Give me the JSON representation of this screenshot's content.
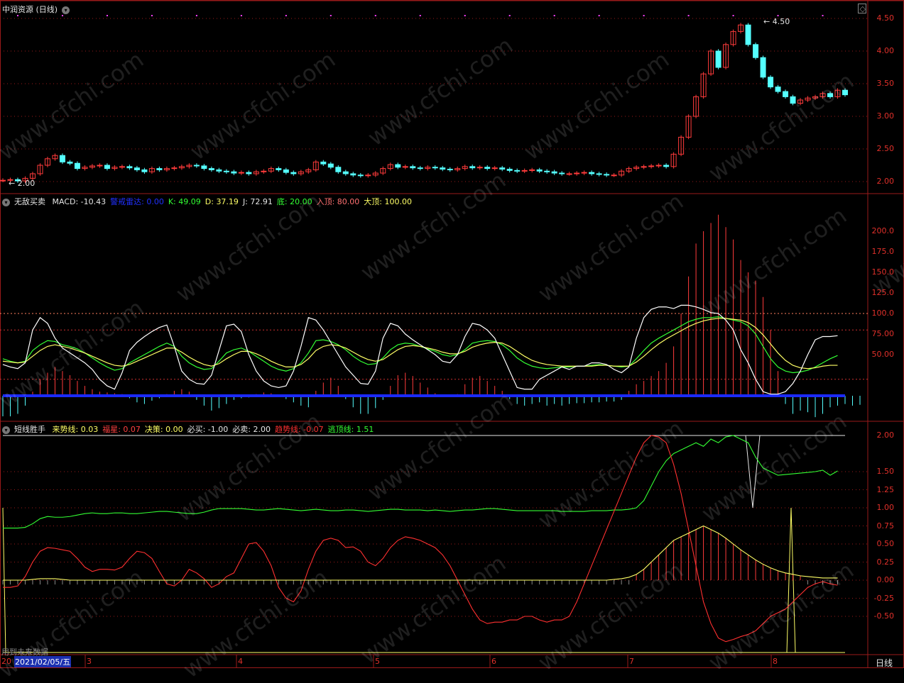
{
  "panel1": {
    "title": "中润资源 (日线)",
    "hi_label": "4.50",
    "lo_label": "2.00",
    "yticks": [
      "4.50",
      "4.00",
      "3.50",
      "3.00",
      "2.50",
      "2.00"
    ]
  },
  "panel2": {
    "name": "无敌买卖",
    "items": [
      {
        "label": "MACD: -10.43",
        "color": "#e6e6e6"
      },
      {
        "label": "警戒雷达: 0.00",
        "color": "#2030ff"
      },
      {
        "label": "K: 49.09",
        "color": "#33ff33"
      },
      {
        "label": "D: 37.19",
        "color": "#ffff66"
      },
      {
        "label": "J: 72.91",
        "color": "#e6e6e6"
      },
      {
        "label": "底: 20.00",
        "color": "#33ff33"
      },
      {
        "label": "入顶: 80.00",
        "color": "#ff7070"
      },
      {
        "label": "大顶: 100.00",
        "color": "#ffff66"
      }
    ],
    "yticks": [
      "200.0",
      "175.0",
      "150.0",
      "125.0",
      "100.0",
      "75.00",
      "50.00"
    ]
  },
  "panel3": {
    "name": "短线胜手",
    "items": [
      {
        "label": "来势线: 0.03",
        "color": "#ffff66"
      },
      {
        "label": "福星: 0.07",
        "color": "#ff4040"
      },
      {
        "label": "决策: 0.00",
        "color": "#ffff66"
      },
      {
        "label": "必买: -1.00",
        "color": "#e6e6e6"
      },
      {
        "label": "必卖: 2.00",
        "color": "#e6e6e6"
      },
      {
        "label": "趋势线: -0.07",
        "color": "#ff3030"
      },
      {
        "label": "逃顶线: 1.51",
        "color": "#33ff33"
      }
    ],
    "yticks": [
      "2.00",
      "1.50",
      "1.25",
      "1.00",
      "0.75",
      "0.50",
      "0.25",
      "0.00",
      "-0.25",
      "-0.50"
    ],
    "footnote": "用到未来数据"
  },
  "dateaxis": {
    "cursor": "2021/02/05/五",
    "months": [
      "3",
      "4",
      "5",
      "6",
      "7",
      "8"
    ],
    "period": "日线"
  },
  "watermark": "www.cfchi.com",
  "colors": {
    "up": "#ff3b3b",
    "down": "#54ffff",
    "grid": "#9a1a1a",
    "axis": "#e0302a"
  },
  "chart_data": {
    "type": "line",
    "title": "中润资源 (日线)",
    "candles_close": [
      2.02,
      2.03,
      2.01,
      2.05,
      2.12,
      2.25,
      2.35,
      2.4,
      2.3,
      2.28,
      2.2,
      2.22,
      2.24,
      2.25,
      2.2,
      2.22,
      2.23,
      2.21,
      2.18,
      2.15,
      2.2,
      2.18,
      2.2,
      2.21,
      2.23,
      2.25,
      2.24,
      2.2,
      2.18,
      2.16,
      2.15,
      2.13,
      2.14,
      2.12,
      2.15,
      2.16,
      2.2,
      2.18,
      2.14,
      2.12,
      2.15,
      2.18,
      2.3,
      2.27,
      2.22,
      2.15,
      2.12,
      2.1,
      2.09,
      2.1,
      2.13,
      2.2,
      2.26,
      2.22,
      2.23,
      2.21,
      2.2,
      2.22,
      2.21,
      2.19,
      2.18,
      2.2,
      2.23,
      2.21,
      2.22,
      2.2,
      2.21,
      2.19,
      2.17,
      2.16,
      2.17,
      2.18,
      2.16,
      2.15,
      2.13,
      2.12,
      2.12,
      2.13,
      2.14,
      2.12,
      2.11,
      2.1,
      2.1,
      2.16,
      2.2,
      2.22,
      2.23,
      2.24,
      2.25,
      2.23,
      2.42,
      2.68,
      3.0,
      3.3,
      3.65,
      4.0,
      3.75,
      4.1,
      4.3,
      4.4,
      4.1,
      3.9,
      3.6,
      3.45,
      3.38,
      3.3,
      3.2,
      3.25,
      3.28,
      3.3,
      3.35,
      3.3,
      3.4,
      3.33
    ],
    "macd_bars": [
      -25,
      -25,
      -22,
      -12,
      5,
      20,
      28,
      35,
      30,
      25,
      18,
      12,
      8,
      5,
      4,
      3,
      2,
      -3,
      -8,
      -10,
      -6,
      -3,
      2,
      6,
      8,
      5,
      -5,
      -12,
      -18,
      -15,
      -10,
      -5,
      -3,
      -2,
      2,
      4,
      3,
      1,
      -4,
      -8,
      -12,
      -14,
      6,
      16,
      22,
      12,
      -4,
      -14,
      -22,
      -22,
      -15,
      -5,
      12,
      25,
      28,
      24,
      16,
      10,
      3,
      -1,
      0,
      2,
      14,
      22,
      24,
      18,
      12,
      6,
      -4,
      -10,
      -12,
      -10,
      -8,
      -12,
      -10,
      -12,
      -10,
      -9,
      -9,
      -8,
      -8,
      -7,
      -7,
      -5,
      6,
      14,
      18,
      24,
      30,
      40,
      60,
      100,
      145,
      185,
      200,
      210,
      220,
      205,
      190,
      165,
      150,
      140,
      120,
      80,
      30,
      -10,
      -22,
      -18,
      -20,
      -26,
      -22,
      -14,
      -12,
      -10,
      -12,
      -11
    ],
    "series_kdj": [
      {
        "name": "K",
        "values": [
          45,
          42,
          40,
          42,
          55,
          62,
          67,
          66,
          62,
          60,
          57,
          52,
          46,
          40,
          35,
          31,
          33,
          40,
          45,
          50,
          55,
          60,
          64,
          60,
          48,
          40,
          35,
          32,
          33,
          42,
          52,
          56,
          58,
          54,
          48,
          42,
          36,
          32,
          30,
          33,
          40,
          52,
          67,
          68,
          66,
          62,
          56,
          48,
          42,
          38,
          39,
          46,
          56,
          62,
          64,
          63,
          60,
          57,
          54,
          50,
          48,
          50,
          56,
          64,
          66,
          67,
          66,
          62,
          55,
          46,
          40,
          36,
          34,
          33,
          34,
          35,
          35,
          36,
          36,
          37,
          38,
          37,
          36,
          35,
          36,
          45,
          55,
          64,
          70,
          75,
          80,
          85,
          90,
          93,
          95,
          95,
          96,
          94,
          92,
          90,
          85,
          75,
          60,
          45,
          35,
          30,
          28,
          29,
          31,
          35,
          40,
          45,
          49
        ]
      },
      {
        "name": "D",
        "values": [
          42,
          41,
          40,
          41,
          48,
          55,
          60,
          62,
          60,
          58,
          55,
          52,
          48,
          44,
          40,
          37,
          36,
          38,
          42,
          46,
          50,
          54,
          58,
          58,
          53,
          47,
          42,
          38,
          36,
          39,
          45,
          50,
          54,
          54,
          51,
          47,
          42,
          38,
          35,
          35,
          38,
          45,
          55,
          60,
          62,
          61,
          58,
          53,
          48,
          44,
          42,
          44,
          50,
          56,
          60,
          61,
          60,
          58,
          56,
          53,
          51,
          51,
          54,
          59,
          62,
          64,
          65,
          64,
          60,
          54,
          48,
          43,
          40,
          38,
          37,
          36,
          36,
          36,
          36,
          36,
          37,
          37,
          36,
          36,
          36,
          41,
          48,
          56,
          63,
          69,
          74,
          79,
          84,
          88,
          91,
          93,
          94,
          94,
          93,
          92,
          89,
          83,
          74,
          63,
          52,
          43,
          37,
          34,
          33,
          34,
          36,
          37,
          37
        ]
      },
      {
        "name": "J",
        "values": [
          38,
          35,
          33,
          40,
          80,
          95,
          88,
          70,
          58,
          52,
          46,
          40,
          32,
          20,
          12,
          8,
          28,
          55,
          65,
          72,
          78,
          83,
          86,
          60,
          30,
          20,
          15,
          14,
          25,
          55,
          85,
          87,
          78,
          50,
          30,
          18,
          12,
          10,
          12,
          30,
          60,
          95,
          92,
          80,
          65,
          50,
          35,
          25,
          15,
          14,
          30,
          70,
          88,
          85,
          75,
          68,
          62,
          56,
          50,
          42,
          40,
          50,
          72,
          88,
          86,
          80,
          70,
          50,
          30,
          10,
          8,
          8,
          20,
          25,
          30,
          35,
          32,
          36,
          36,
          40,
          40,
          38,
          32,
          28,
          35,
          70,
          95,
          105,
          108,
          108,
          106,
          110,
          110,
          108,
          105,
          101,
          100,
          92,
          80,
          56,
          40,
          20,
          5,
          2,
          2,
          5,
          15,
          30,
          50,
          68,
          72,
          72,
          73
        ]
      }
    ],
    "series_p3": [
      {
        "name": "逃顶线",
        "values": [
          0.72,
          0.72,
          0.72,
          0.73,
          0.78,
          0.85,
          0.88,
          0.87,
          0.87,
          0.88,
          0.9,
          0.92,
          0.93,
          0.92,
          0.92,
          0.93,
          0.93,
          0.92,
          0.92,
          0.93,
          0.94,
          0.95,
          0.95,
          0.94,
          0.93,
          0.92,
          0.92,
          0.94,
          0.97,
          0.99,
          0.99,
          0.99,
          0.99,
          0.98,
          0.97,
          0.97,
          0.98,
          0.99,
          0.98,
          0.97,
          0.96,
          0.97,
          0.98,
          0.97,
          0.96,
          0.96,
          0.97,
          0.97,
          0.96,
          0.95,
          0.96,
          0.97,
          0.98,
          0.98,
          0.97,
          0.97,
          0.97,
          0.96,
          0.97,
          0.96,
          0.95,
          0.96,
          0.97,
          0.97,
          0.98,
          0.99,
          0.99,
          0.98,
          0.97,
          0.96,
          0.96,
          0.96,
          0.96,
          0.96,
          0.96,
          0.95,
          0.95,
          0.95,
          0.95,
          0.96,
          0.96,
          0.96,
          0.97,
          0.97,
          0.98,
          1.0,
          1.1,
          1.3,
          1.5,
          1.65,
          1.75,
          1.8,
          1.85,
          1.9,
          1.85,
          1.95,
          1.9,
          1.98,
          2.0,
          1.95,
          1.9,
          1.7,
          1.55,
          1.5,
          1.45,
          1.46,
          1.47,
          1.48,
          1.49,
          1.5,
          1.52,
          1.45,
          1.51
        ]
      },
      {
        "name": "趋势线",
        "values": [
          -0.1,
          -0.1,
          -0.08,
          0.05,
          0.25,
          0.4,
          0.45,
          0.44,
          0.42,
          0.4,
          0.3,
          0.18,
          0.12,
          0.15,
          0.15,
          0.14,
          0.18,
          0.3,
          0.4,
          0.38,
          0.3,
          0.12,
          -0.05,
          -0.08,
          0.0,
          0.15,
          0.1,
          0.02,
          -0.1,
          -0.05,
          0.05,
          0.1,
          0.3,
          0.5,
          0.52,
          0.4,
          0.2,
          -0.1,
          -0.25,
          -0.3,
          -0.15,
          0.15,
          0.4,
          0.55,
          0.58,
          0.55,
          0.45,
          0.46,
          0.4,
          0.25,
          0.2,
          0.3,
          0.45,
          0.55,
          0.6,
          0.58,
          0.55,
          0.5,
          0.45,
          0.35,
          0.2,
          0.0,
          -0.2,
          -0.4,
          -0.55,
          -0.6,
          -0.58,
          -0.58,
          -0.55,
          -0.55,
          -0.5,
          -0.5,
          -0.55,
          -0.58,
          -0.55,
          -0.55,
          -0.5,
          -0.3,
          -0.05,
          0.2,
          0.45,
          0.7,
          0.95,
          1.2,
          1.45,
          1.7,
          1.9,
          2.0,
          1.98,
          1.9,
          1.6,
          1.2,
          0.7,
          0.2,
          -0.3,
          -0.6,
          -0.8,
          -0.85,
          -0.82,
          -0.78,
          -0.75,
          -0.7,
          -0.6,
          -0.5,
          -0.45,
          -0.4,
          -0.3,
          -0.2,
          -0.1,
          -0.05,
          -0.02,
          -0.05,
          -0.07
        ]
      },
      {
        "name": "来势线",
        "values": [
          0.0,
          0.0,
          0.0,
          0.0,
          0.01,
          0.02,
          0.02,
          0.02,
          0.01,
          0.0,
          0.0,
          0.0,
          0.0,
          0.0,
          0.0,
          0.0,
          0.0,
          0.0,
          0.0,
          0.0,
          0.0,
          0.0,
          0.0,
          0.0,
          0.0,
          0.0,
          0.0,
          0.0,
          0.0,
          0.0,
          0.0,
          0.0,
          0.0,
          0.0,
          0.0,
          0.0,
          0.0,
          0.0,
          0.0,
          0.0,
          0.0,
          0.0,
          0.0,
          0.0,
          0.0,
          0.0,
          0.0,
          0.0,
          0.0,
          0.0,
          0.0,
          0.0,
          0.0,
          0.0,
          0.0,
          0.0,
          0.0,
          0.0,
          0.0,
          0.0,
          0.0,
          0.0,
          0.0,
          0.0,
          0.0,
          0.0,
          0.0,
          0.0,
          0.0,
          0.0,
          0.0,
          0.0,
          0.0,
          0.0,
          0.0,
          0.0,
          0.0,
          0.0,
          0.0,
          0.0,
          0.0,
          0.0,
          0.01,
          0.02,
          0.04,
          0.08,
          0.15,
          0.25,
          0.35,
          0.45,
          0.55,
          0.6,
          0.65,
          0.7,
          0.75,
          0.7,
          0.65,
          0.58,
          0.5,
          0.42,
          0.35,
          0.28,
          0.22,
          0.17,
          0.13,
          0.1,
          0.08,
          0.06,
          0.05,
          0.04,
          0.03,
          0.03,
          0.03
        ]
      }
    ]
  }
}
